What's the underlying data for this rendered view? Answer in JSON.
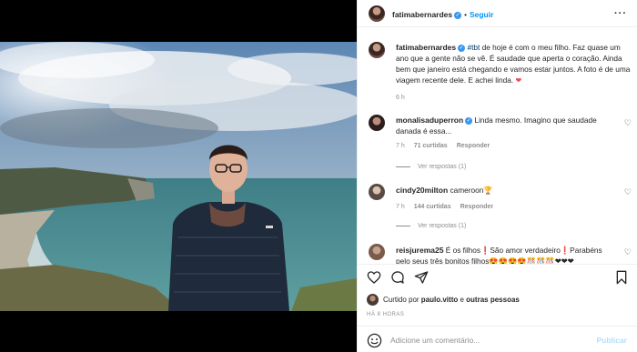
{
  "post": {
    "username": "fatimabernardes",
    "follow_label": "Seguir",
    "more_label": "···"
  },
  "caption": {
    "username": "fatimabernardes",
    "hashtag": "#tbt",
    "text": " de hoje é com o meu filho. Faz quase um ano que a gente não se vê. É saudade que aperta o coração. Ainda bem que janeiro está chegando e vamos estar juntos. A foto é de uma viagem recente dele. E achei linda. ",
    "emoji": "❤",
    "time": "6 h"
  },
  "comments": [
    {
      "username": "monalisaduperron",
      "text": "Linda mesmo. Imagino que saudade danada é essa...",
      "time": "7 h",
      "likes": "71 curtidas",
      "reply": "Responder",
      "view_replies": "Ver respostas (1)"
    },
    {
      "username": "cindy20milton",
      "text": "cameroon🏆",
      "time": "7 h",
      "likes": "144 curtidas",
      "reply": "Responder",
      "view_replies": "Ver respostas (1)"
    },
    {
      "username": "reisjurema25",
      "text": "É os filhos❗São amor verdadeiro❗Parabéns pelo seus três bonitos filhos😍😍😍😍🎊🎊🎊❤❤❤",
      "time": "",
      "likes": "",
      "reply": "",
      "view_replies": ""
    }
  ],
  "liked_by": {
    "prefix": "Curtido por ",
    "user": "paulo.vitto",
    "suffix": " e ",
    "others": "outras pessoas"
  },
  "posted_ago": "HÁ 8 HORAS",
  "add_comment": {
    "placeholder": "Adicione um comentário...",
    "publish_label": "Publicar"
  },
  "icons": [
    "heart-icon",
    "comment-icon",
    "share-icon",
    "bookmark-icon",
    "emoji-icon",
    "verified-icon"
  ],
  "colors": {
    "link_blue": "#0095f6",
    "publish_disabled": "#b2dffc",
    "muted_text": "#8e8e8e",
    "heart_red": "#ed4956"
  }
}
